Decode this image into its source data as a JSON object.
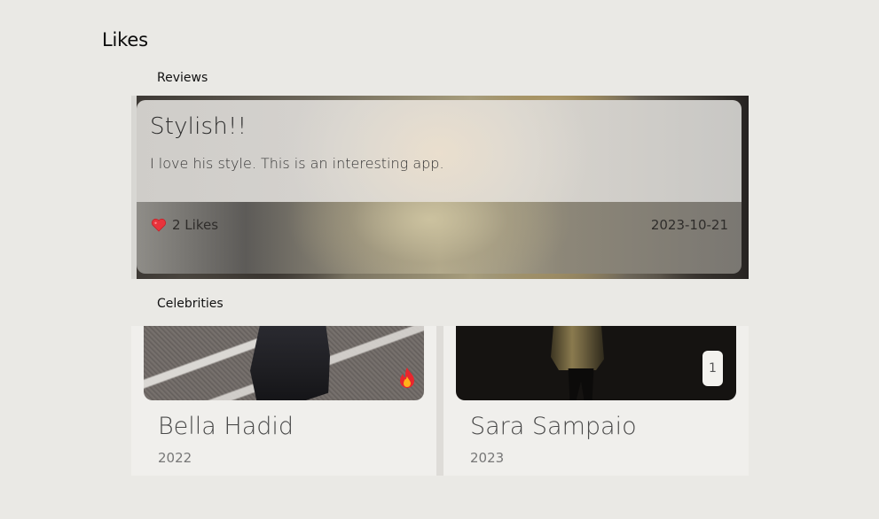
{
  "page": {
    "title": "Likes"
  },
  "sections": {
    "reviews_label": "Reviews",
    "celebrities_label": "Celebrities"
  },
  "review": {
    "title": "Stylish!!",
    "body": "I love his style. This is an interesting app.",
    "likes_text": "2 Likes",
    "date": "2023-10-21",
    "like_icon": "heart-icon"
  },
  "celebrities": [
    {
      "name": "Bella Hadid",
      "year": "2022",
      "badge_icon": "fire-icon"
    },
    {
      "name": "Sara Sampaio",
      "year": "2023",
      "badge_count": "1"
    }
  ],
  "colors": {
    "background": "#eae9e5",
    "card": "#f0efec",
    "heart": "#e8343c"
  }
}
